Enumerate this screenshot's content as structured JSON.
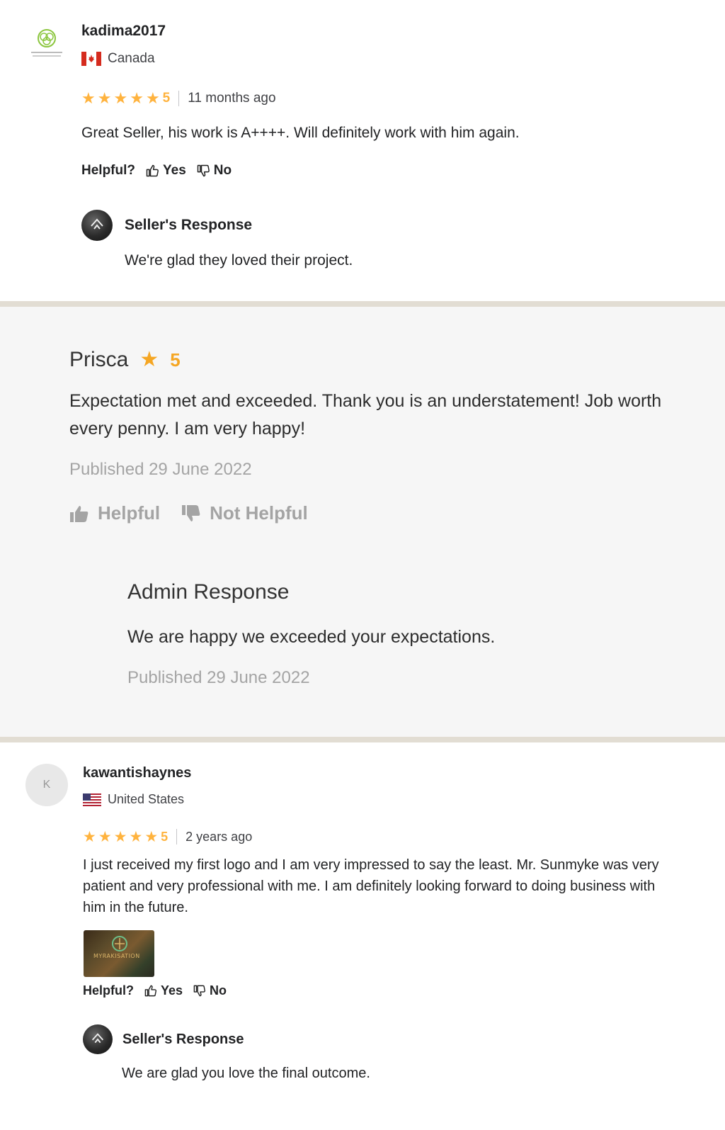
{
  "review1": {
    "username": "kadima2017",
    "country": "Canada",
    "rating": "5",
    "time": "11 months ago",
    "text": "Great Seller, his work is A++++. Will definitely work with him again.",
    "helpful_label": "Helpful?",
    "yes_label": "Yes",
    "no_label": "No",
    "response_title": "Seller's Response",
    "response_text": "We're glad they loved their project."
  },
  "review2": {
    "name": "Prisca",
    "rating": "5",
    "text": "Expectation met and exceeded. Thank you is an understatement! Job worth every penny. I am very happy!",
    "published": "Published 29 June 2022",
    "helpful_label": "Helpful",
    "not_helpful_label": "Not Helpful",
    "admin_title": "Admin Response",
    "admin_text": "We are happy we exceeded your expectations.",
    "admin_published": "Published 29 June 2022"
  },
  "review3": {
    "avatar_letter": "K",
    "username": "kawantishaynes",
    "country": "United States",
    "rating": "5",
    "time": "2 years ago",
    "text": "I just received my first logo and I am very impressed to say the least. Mr. Sunmyke was very patient and very professional with me. I am definitely looking forward to doing business with him in the future.",
    "helpful_label": "Helpful?",
    "yes_label": "Yes",
    "no_label": "No",
    "response_title": "Seller's Response",
    "response_text": "We are glad you love the final outcome."
  },
  "colors": {
    "star": "#ffb33e",
    "admin_star": "#f5a623",
    "divider": "#e2ddd3",
    "admin_bg": "#f6f6f6",
    "muted": "#a4a4a4"
  },
  "icons": [
    "organic-logo-avatar-icon",
    "canada-flag-icon",
    "usa-flag-icon",
    "star-icon",
    "thumbs-up-icon",
    "thumbs-down-icon",
    "seller-avatar-icon"
  ]
}
